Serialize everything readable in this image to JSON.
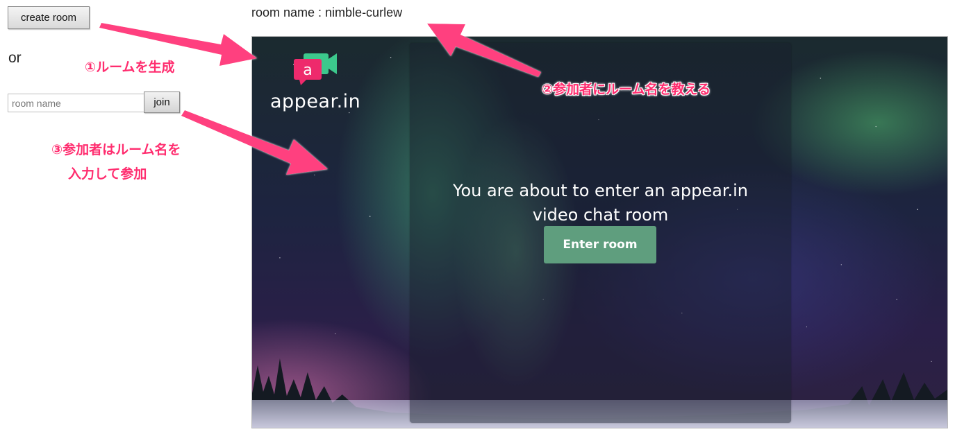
{
  "controls": {
    "create_room_label": "create room",
    "or_text": "or",
    "room_name_placeholder": "room name",
    "join_label": "join"
  },
  "room_name_line": "room name : nimble-curlew",
  "appear": {
    "logo_text": "appear.in",
    "logo_letter": "a",
    "message_line1": "You are about to enter an appear.in",
    "message_line2": "video chat room",
    "enter_button_label": "Enter room"
  },
  "annotations": {
    "step1": "①ルームを生成",
    "step2": "②参加者にルーム名を教える",
    "step3_line1": "③参加者はルーム名を",
    "step3_line2": "入力して参加"
  },
  "colors": {
    "annotation_pink": "#ff2d6f",
    "logo_pink": "#ee2a6c",
    "logo_green": "#3cc88c",
    "enter_button_green": "#5f9e7e"
  }
}
